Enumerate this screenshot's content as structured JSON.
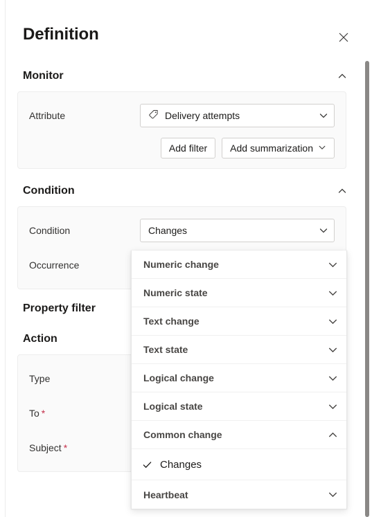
{
  "panel": {
    "title": "Definition",
    "close_icon": "close-icon"
  },
  "sections": {
    "monitor": {
      "title": "Monitor",
      "collapse_icon": "chevron-up-icon",
      "attribute": {
        "label": "Attribute",
        "value": "Delivery attempts",
        "value_icon": "tag-icon",
        "dropdown_icon": "chevron-down-icon"
      },
      "buttons": {
        "add_filter": "Add filter",
        "add_summarization": "Add summarization",
        "add_summarization_icon": "chevron-down-icon"
      }
    },
    "condition": {
      "title": "Condition",
      "collapse_icon": "chevron-up-icon",
      "condition_field": {
        "label": "Condition",
        "value": "Changes",
        "dropdown_icon": "chevron-down-icon"
      },
      "occurrence_field": {
        "label": "Occurrence"
      }
    },
    "property_filter": {
      "title": "Property filter"
    },
    "action": {
      "title": "Action",
      "fields": [
        {
          "label": "Type",
          "required": false
        },
        {
          "label": "To",
          "required": true
        },
        {
          "label": "Subject",
          "required": true
        }
      ],
      "required_marker": "*"
    }
  },
  "condition_dropdown": {
    "open": true,
    "items": [
      {
        "label": "Numeric change",
        "icon": "chevron-down-icon",
        "expanded": false,
        "type": "group"
      },
      {
        "label": "Numeric state",
        "icon": "chevron-down-icon",
        "expanded": false,
        "type": "group"
      },
      {
        "label": "Text change",
        "icon": "chevron-down-icon",
        "expanded": false,
        "type": "group"
      },
      {
        "label": "Text state",
        "icon": "chevron-down-icon",
        "expanded": false,
        "type": "group"
      },
      {
        "label": "Logical change",
        "icon": "chevron-down-icon",
        "expanded": false,
        "type": "group"
      },
      {
        "label": "Logical state",
        "icon": "chevron-down-icon",
        "expanded": false,
        "type": "group"
      },
      {
        "label": "Common change",
        "icon": "chevron-up-icon",
        "expanded": true,
        "type": "group"
      },
      {
        "label": "Changes",
        "icon": "check-icon",
        "selected": true,
        "type": "option"
      },
      {
        "label": "Heartbeat",
        "icon": "chevron-down-icon",
        "expanded": false,
        "type": "group"
      }
    ]
  },
  "scrollbar": {
    "name": "vertical-scrollbar"
  },
  "colors": {
    "text_primary": "#1b1a19",
    "text_secondary": "#484644",
    "required_red": "#c4314b",
    "card_bg": "#fafafa",
    "border": "#d2d0ce"
  }
}
